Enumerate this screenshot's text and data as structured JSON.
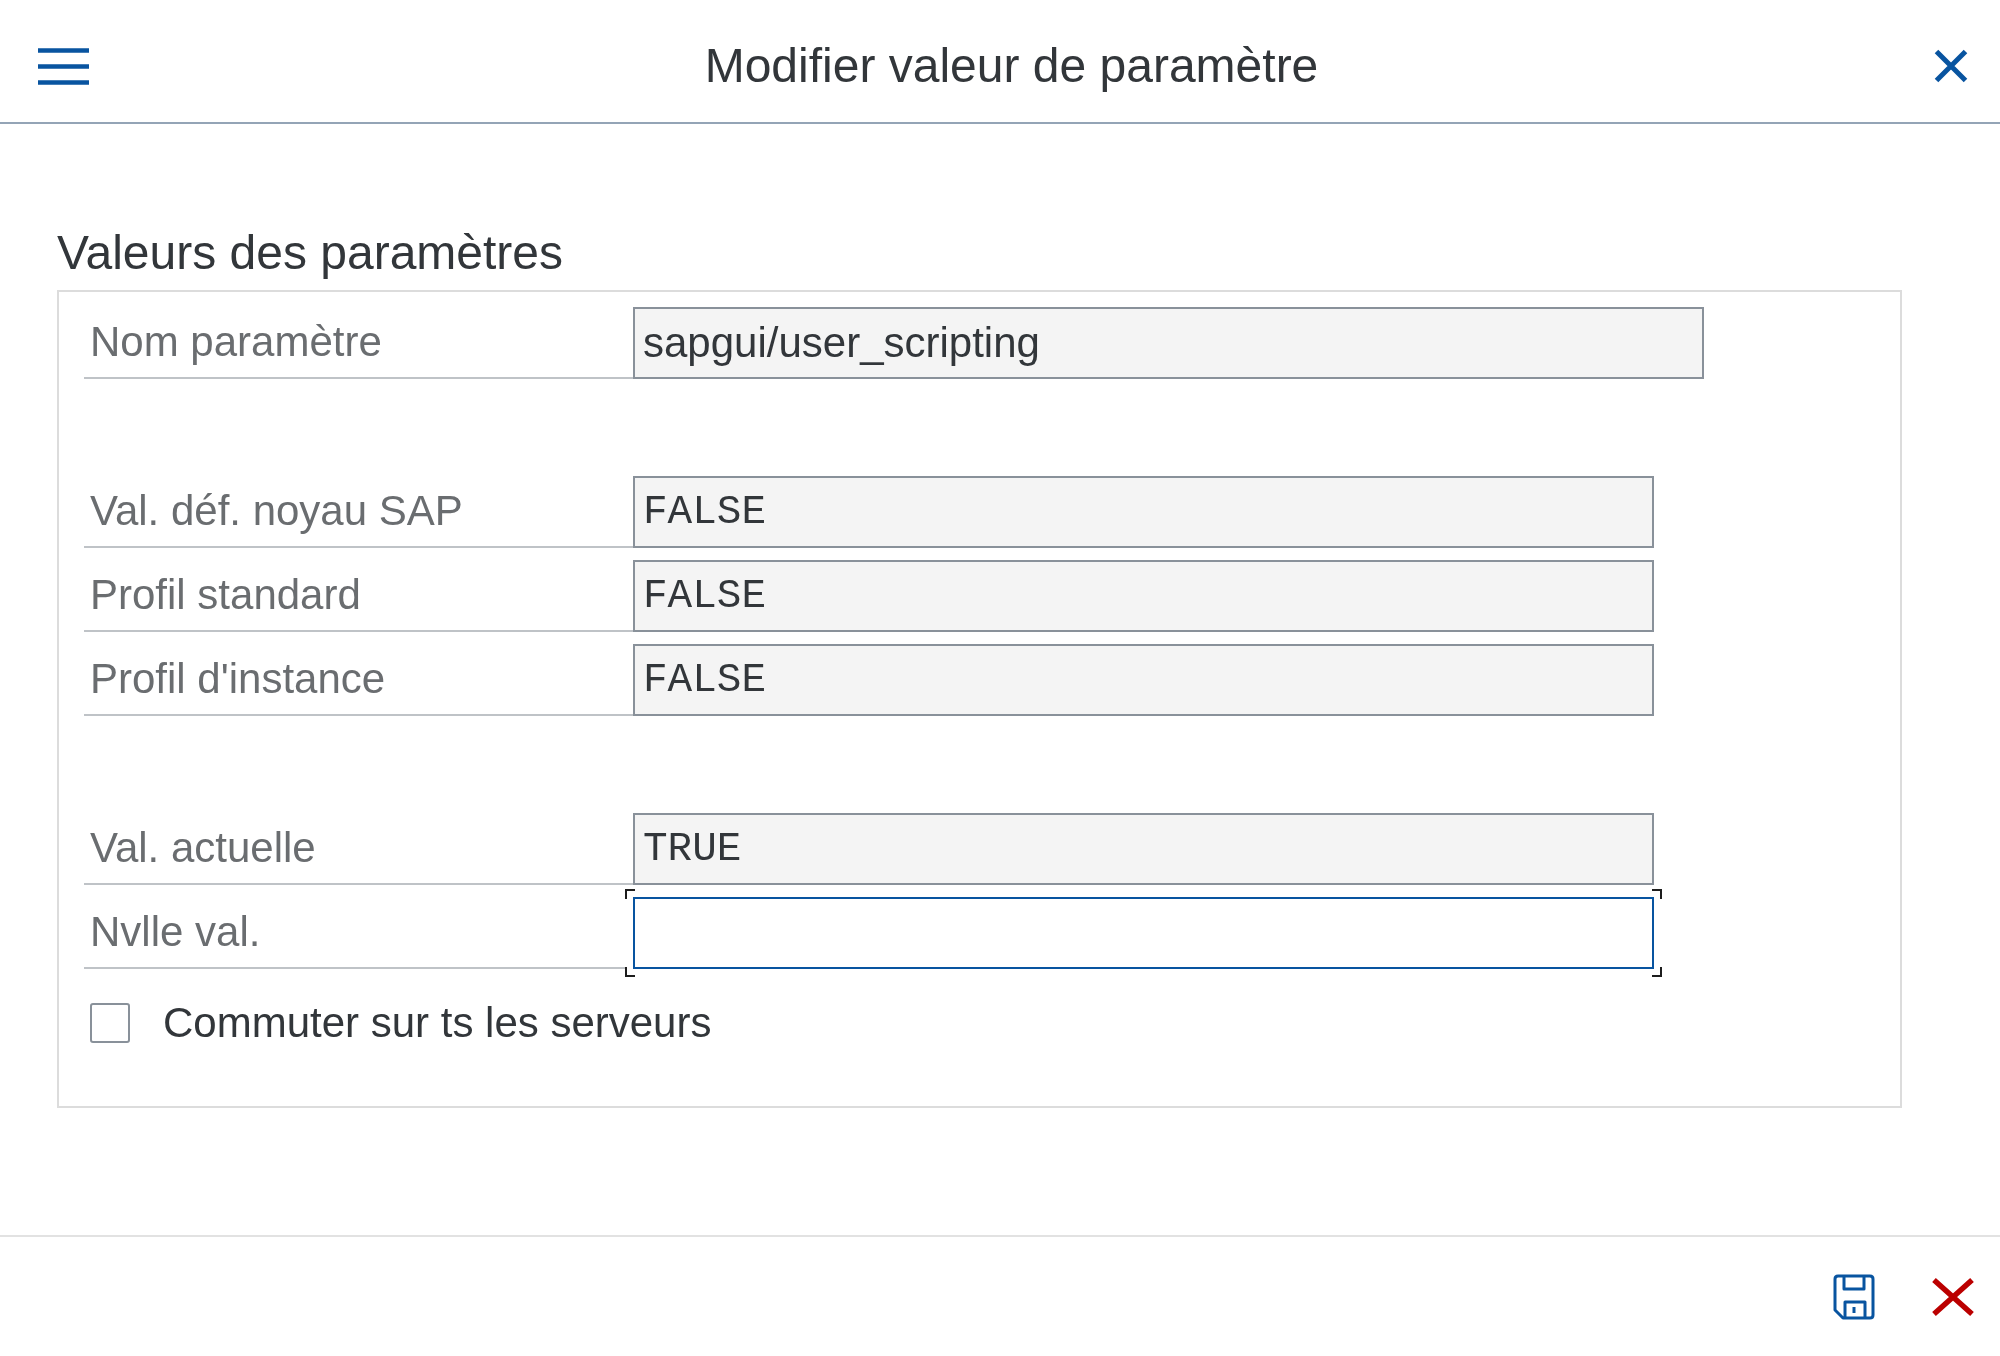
{
  "dialog": {
    "title": "Modifier valeur de paramètre"
  },
  "section": {
    "title": "Valeurs des paramètres",
    "groups": [
      {
        "fields": [
          {
            "label": "Nom paramètre",
            "value": "sapgui/user_scripting",
            "kind": "text",
            "focused": false
          }
        ]
      },
      {
        "fields": [
          {
            "label": "Val. déf. noyau SAP",
            "value": "FALSE",
            "kind": "mono",
            "focused": false
          },
          {
            "label": "Profil standard",
            "value": "FALSE",
            "kind": "mono",
            "focused": false
          },
          {
            "label": "Profil d'instance",
            "value": "FALSE",
            "kind": "mono",
            "focused": false
          }
        ]
      },
      {
        "fields": [
          {
            "label": "Val. actuelle",
            "value": "TRUE",
            "kind": "mono",
            "focused": false
          },
          {
            "label": "Nvlle val.",
            "kind": "mono",
            "focused": true
          }
        ]
      }
    ],
    "checkbox": {
      "label": "Commuter sur ts les serveurs",
      "checked": false
    }
  }
}
